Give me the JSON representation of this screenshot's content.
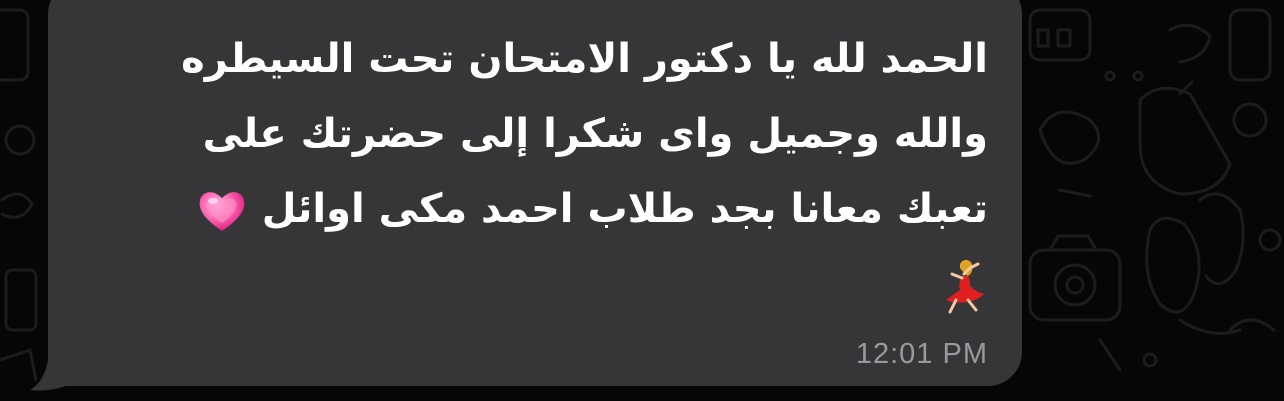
{
  "message": {
    "lines": [
      "الحمد لله يا دكتور الامتحان تحت السيطره",
      "والله وجميل واى شكرا إلى حضرتك على",
      "تعبك معانا بجد طلاب احمد مكى اوائل"
    ],
    "emojis": [
      "growing-heart-emoji",
      "dancer-emoji"
    ],
    "time": "12:01 PM"
  },
  "colors": {
    "background": "#060606",
    "bubble": "#363638",
    "text": "#ffffff",
    "timestamp": "#9a9a9e"
  }
}
